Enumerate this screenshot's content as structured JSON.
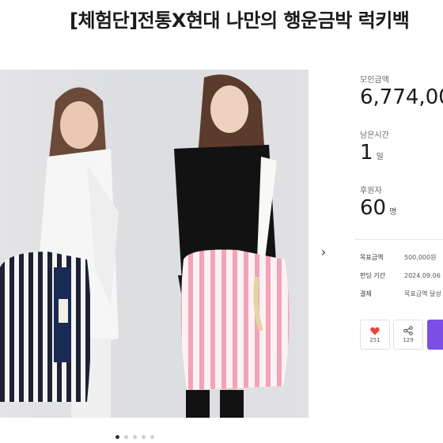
{
  "project": {
    "title": "[체험단]전통X현대 나만의 행운금박 럭키백"
  },
  "stats": {
    "funded_label": "모인금액",
    "funded_value": "6,774,00",
    "remaining_label": "남은시간",
    "remaining_value": "1",
    "remaining_unit": "일",
    "supporters_label": "후원자",
    "supporters_value": "60",
    "supporters_unit": "명"
  },
  "info": [
    {
      "key": "목표금액",
      "value": "500,000원"
    },
    {
      "key": "펀딩 기간",
      "value": "2024.09.06"
    },
    {
      "key": "결제",
      "value": "목표금액 달성"
    }
  ],
  "actions": {
    "like_count": "251",
    "share_count": "129"
  },
  "carousel": {
    "slide_count": 5,
    "active_index": 0
  },
  "colors": {
    "accent": "#7b4ee8",
    "heart": "#e8453c"
  },
  "icons": [
    "chevron-right-icon",
    "heart-icon",
    "share-icon"
  ]
}
